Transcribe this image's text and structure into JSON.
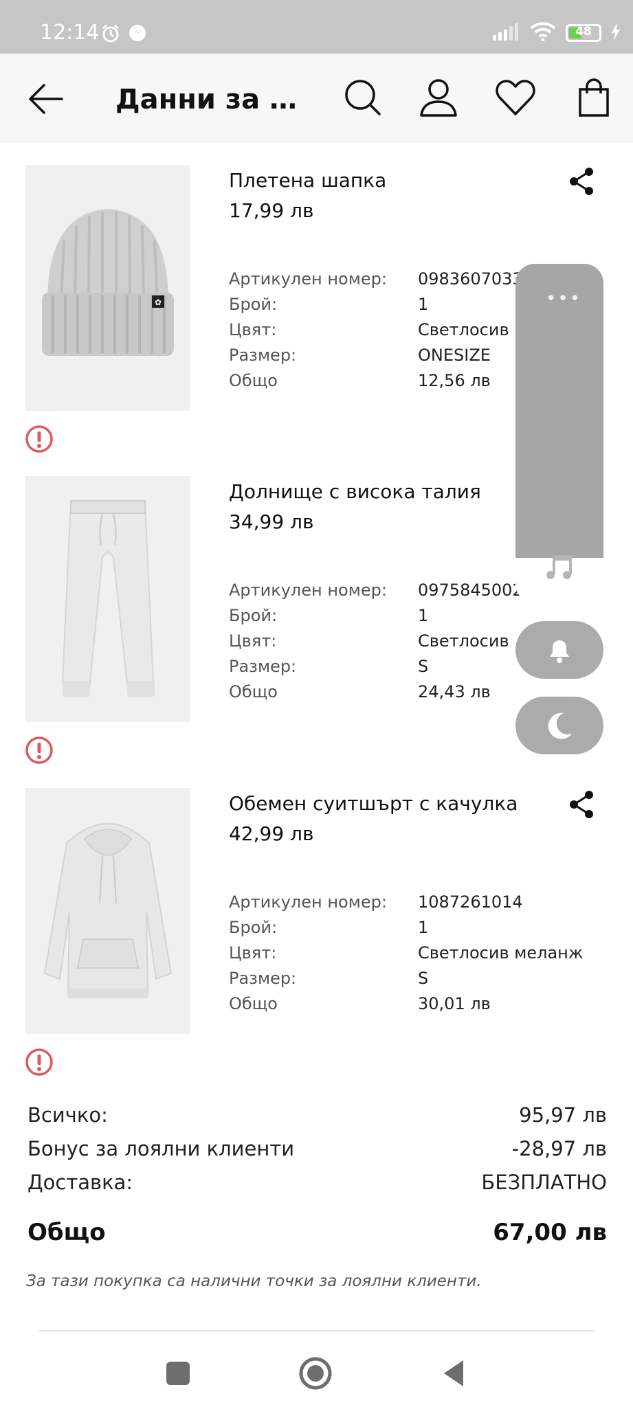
{
  "status_bar": {
    "time": "12:14",
    "battery_level": "48",
    "battery_fraction": 0.48,
    "icons": [
      "alarm-icon",
      "messenger-icon",
      "signal-icon",
      "wifi-icon",
      "battery-icon",
      "charging-icon"
    ]
  },
  "header": {
    "title": "Данни за по...",
    "icons": [
      "back-arrow-icon",
      "search-icon",
      "account-icon",
      "heart-icon",
      "shopping-bag-icon"
    ]
  },
  "labels": {
    "article_no": "Артикулен номер:",
    "qty": "Брой:",
    "color": "Цвят:",
    "size": "Размер:",
    "total": "Общо"
  },
  "items": [
    {
      "name": "Плетена шапка",
      "price": "17,99 лв",
      "article_no": "0983607033",
      "qty": "1",
      "color": "Светлосив",
      "size": "ONESIZE",
      "total": "12,56 лв"
    },
    {
      "name": "Долнище с висока талия",
      "price": "34,99 лв",
      "article_no": "0975845002",
      "qty": "1",
      "color": "Светлосив",
      "size": "S",
      "total": "24,43 лв"
    },
    {
      "name": "Обемен суитшърт с качулка",
      "price": "42,99 лв",
      "article_no": "1087261014",
      "qty": "1",
      "color": "Светлосив меланж",
      "size": "S",
      "total": "30,01 лв"
    }
  ],
  "summary": {
    "subtotal_label": "Всичко:",
    "subtotal_value": "95,97 лв",
    "bonus_label": "Бонус за лоялни клиенти",
    "bonus_value": "-28,97 лв",
    "delivery_label": "Доставка:",
    "delivery_value": "БЕЗПЛАТНО",
    "total_label": "Общо",
    "total_value": "67,00 лв",
    "loyalty_note": "За тази покупка са налични точки за лоялни клиенти."
  },
  "floating_panel": {
    "dots": "•••",
    "icons": [
      "music-note-icon",
      "bell-icon",
      "moon-icon"
    ]
  },
  "colors": {
    "status_bar": "#c6c6c6",
    "app_bar": "#f7f7f7",
    "warning": "#e05a5a",
    "text": "#111111"
  }
}
